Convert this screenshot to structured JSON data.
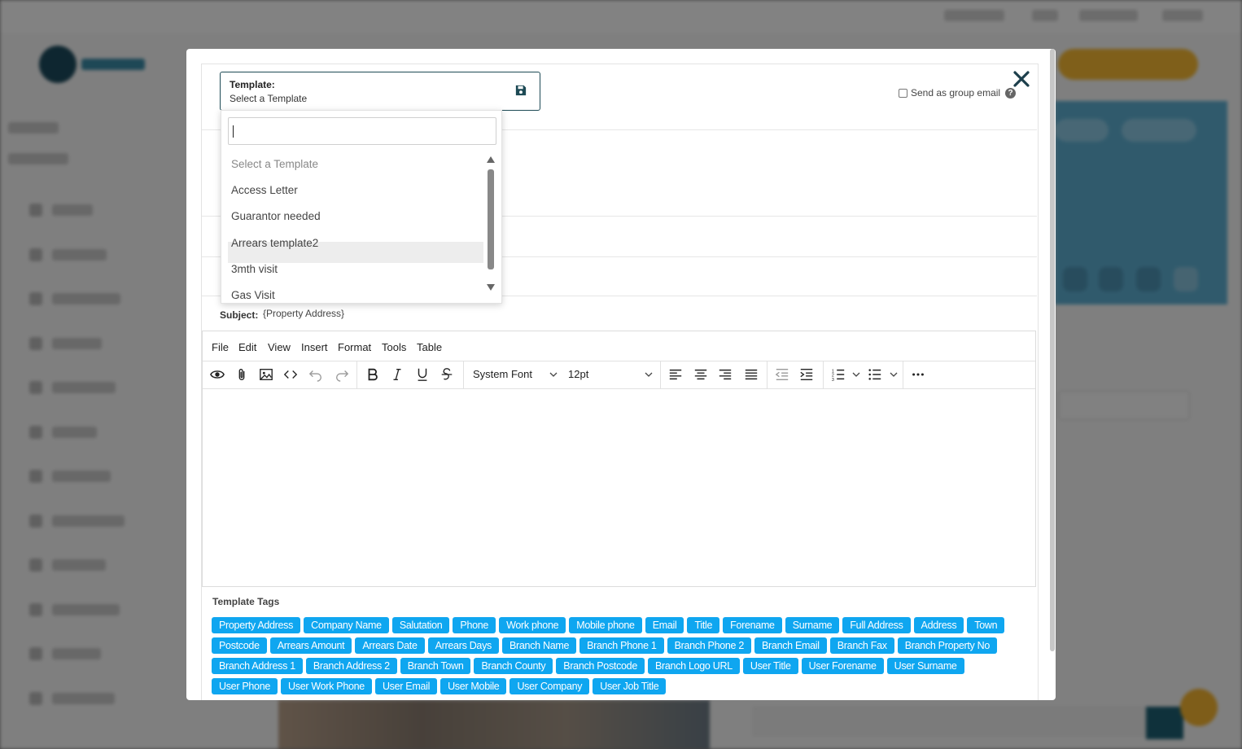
{
  "background": {
    "sidebar_items": 12
  },
  "template": {
    "label": "Template:",
    "selected": "Select a Template"
  },
  "group_email": {
    "label": "Send as group email",
    "checked": false
  },
  "dropdown": {
    "search_value": "",
    "options": [
      "Select a Template",
      "Access Letter",
      "Guarantor needed",
      "Arrears template2",
      "3mth visit",
      "Gas Visit"
    ],
    "highlighted": "Gas Visit"
  },
  "subject": {
    "label": "Subject:",
    "value": "{Property Address}"
  },
  "editor": {
    "menu": [
      "File",
      "Edit",
      "View",
      "Insert",
      "Format",
      "Tools",
      "Table"
    ],
    "font_family": "System Font",
    "font_size": "12pt",
    "icons": [
      "preview-icon",
      "attachment-icon",
      "image-icon",
      "code-icon",
      "undo-icon",
      "redo-icon",
      "bold-icon",
      "italic-icon",
      "underline-icon",
      "strikethrough-icon",
      "align-left-icon",
      "align-center-icon",
      "align-right-icon",
      "align-justify-icon",
      "outdent-icon",
      "indent-icon",
      "numbered-list-icon",
      "bullet-list-icon",
      "more-icon"
    ]
  },
  "tags": {
    "title": "Template Tags",
    "items": [
      "Property Address",
      "Company Name",
      "Salutation",
      "Phone",
      "Work phone",
      "Mobile phone",
      "Email",
      "Title",
      "Forename",
      "Surname",
      "Full Address",
      "Address",
      "Town",
      "Postcode",
      "Arrears Amount",
      "Arrears Date",
      "Arrears Days",
      "Branch Name",
      "Branch Phone 1",
      "Branch Phone 2",
      "Branch Email",
      "Branch Fax",
      "Branch Property No",
      "Branch Address 1",
      "Branch Address 2",
      "Branch Town",
      "Branch County",
      "Branch Postcode",
      "Branch Logo URL",
      "User Title",
      "User Forename",
      "User Surname",
      "User Phone",
      "User Work Phone",
      "User Email",
      "User Mobile",
      "User Company",
      "User Job Title"
    ]
  },
  "colors": {
    "tag_bg": "#0fa6f0",
    "accent_dark": "#1d4a55"
  }
}
